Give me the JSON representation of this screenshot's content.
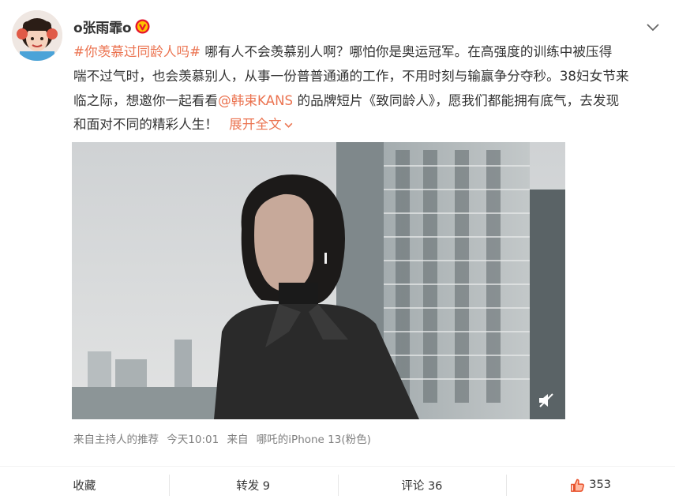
{
  "post": {
    "username": "o张雨霏o",
    "hashtag": "#你羡慕过同龄人吗#",
    "text_line1": " 哪有人不会羡慕别人啊？哪怕你是奥运冠军。在高强度的训练中被压得",
    "text_line2": "喘不过气时，也会羡慕别人，从事一份普普通通的工作，不用时刻与输赢争分夺秒。38妇女节来",
    "text_line3a": "临之际，想邀你一起看看",
    "mention": "@韩束KANS",
    "text_line3b": " 的品牌短片《致同龄人》，愿我们都能拥有底气，去发现",
    "text_line4": "和面对不同的精彩人生！",
    "expand_label": "展开全文"
  },
  "source": {
    "recommend": "来自主持人的推荐",
    "time": "今天10:01",
    "from": "来自",
    "device": "哪吒的iPhone 13(粉色)"
  },
  "actions": {
    "favorite": "收藏",
    "repost": "转发 9",
    "comment": "评论 36",
    "like_count": "353"
  },
  "icons": {
    "vip": "verified-badge-icon",
    "menu": "chevron-down-icon",
    "mute": "mute-icon",
    "like": "thumbs-up-icon"
  },
  "colors": {
    "link": "#eb7350",
    "badge": "#e6162d",
    "badge_inner": "#ffc300"
  }
}
